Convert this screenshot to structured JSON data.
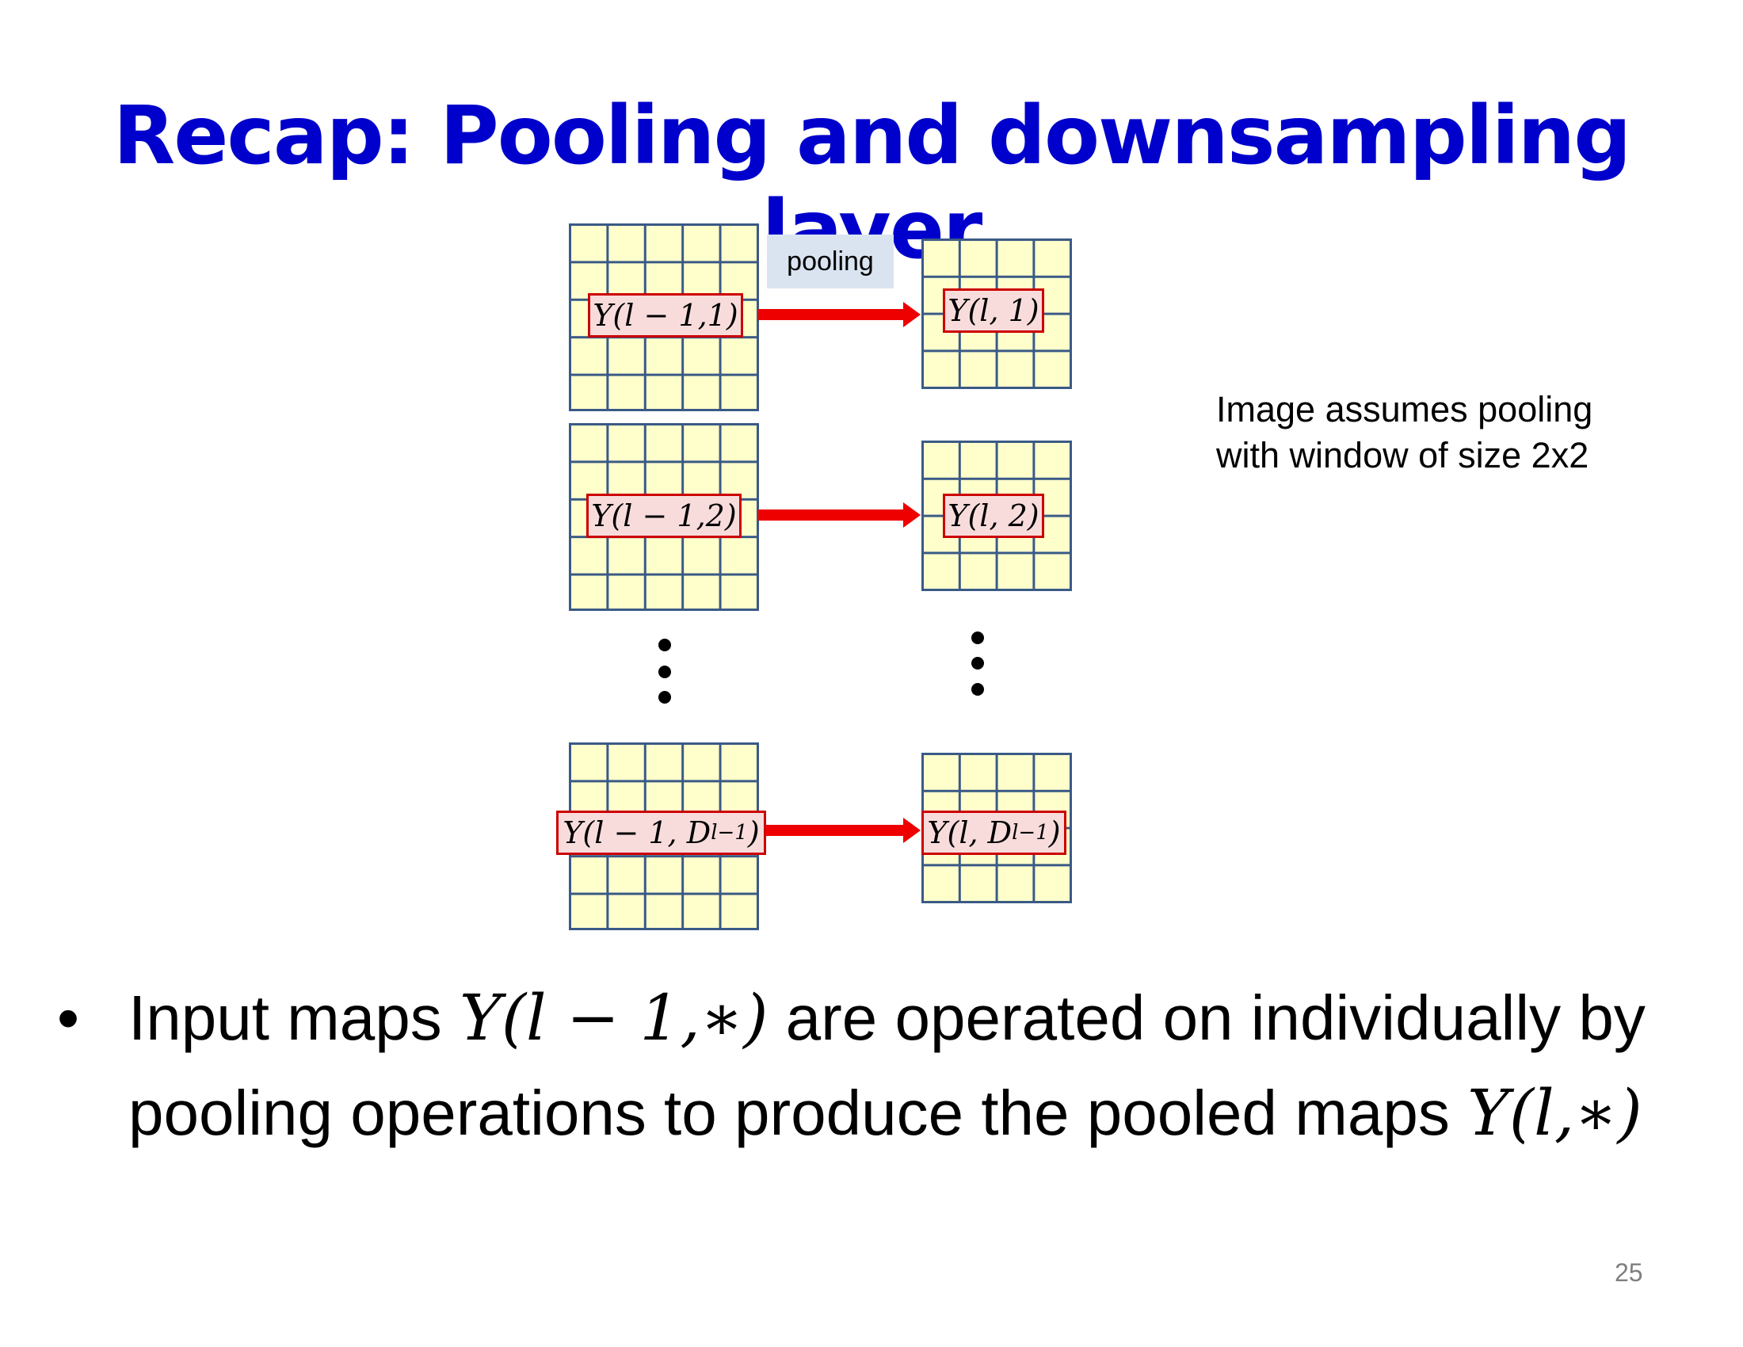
{
  "slide": {
    "title": "Recap: Pooling and downsampling layer",
    "page_number": "25"
  },
  "diagram": {
    "pooling_label": "pooling",
    "rows": [
      {
        "input_label": "Y(l − 1,1)",
        "output_label": "Y(l, 1)"
      },
      {
        "input_label": "Y(l − 1,2)",
        "output_label": "Y(l, 2)"
      },
      {
        "input_label_main": "Y(l − 1, D",
        "input_label_sub": "l−1",
        "input_label_close": ")",
        "output_label_main": "Y(l, D",
        "output_label_sub": "l−1",
        "output_label_close": ")"
      }
    ],
    "ellipsis": "⋮",
    "note_line1": "Image assumes pooling",
    "note_line2": "with window of size 2x2"
  },
  "bullet": {
    "marker": "•",
    "text_a": "Input maps ",
    "math_a": "Y(l − 1,∗)",
    "text_b": " are operated on individually by pooling operations to produce the pooled maps ",
    "math_b": "Y(l,∗)"
  }
}
